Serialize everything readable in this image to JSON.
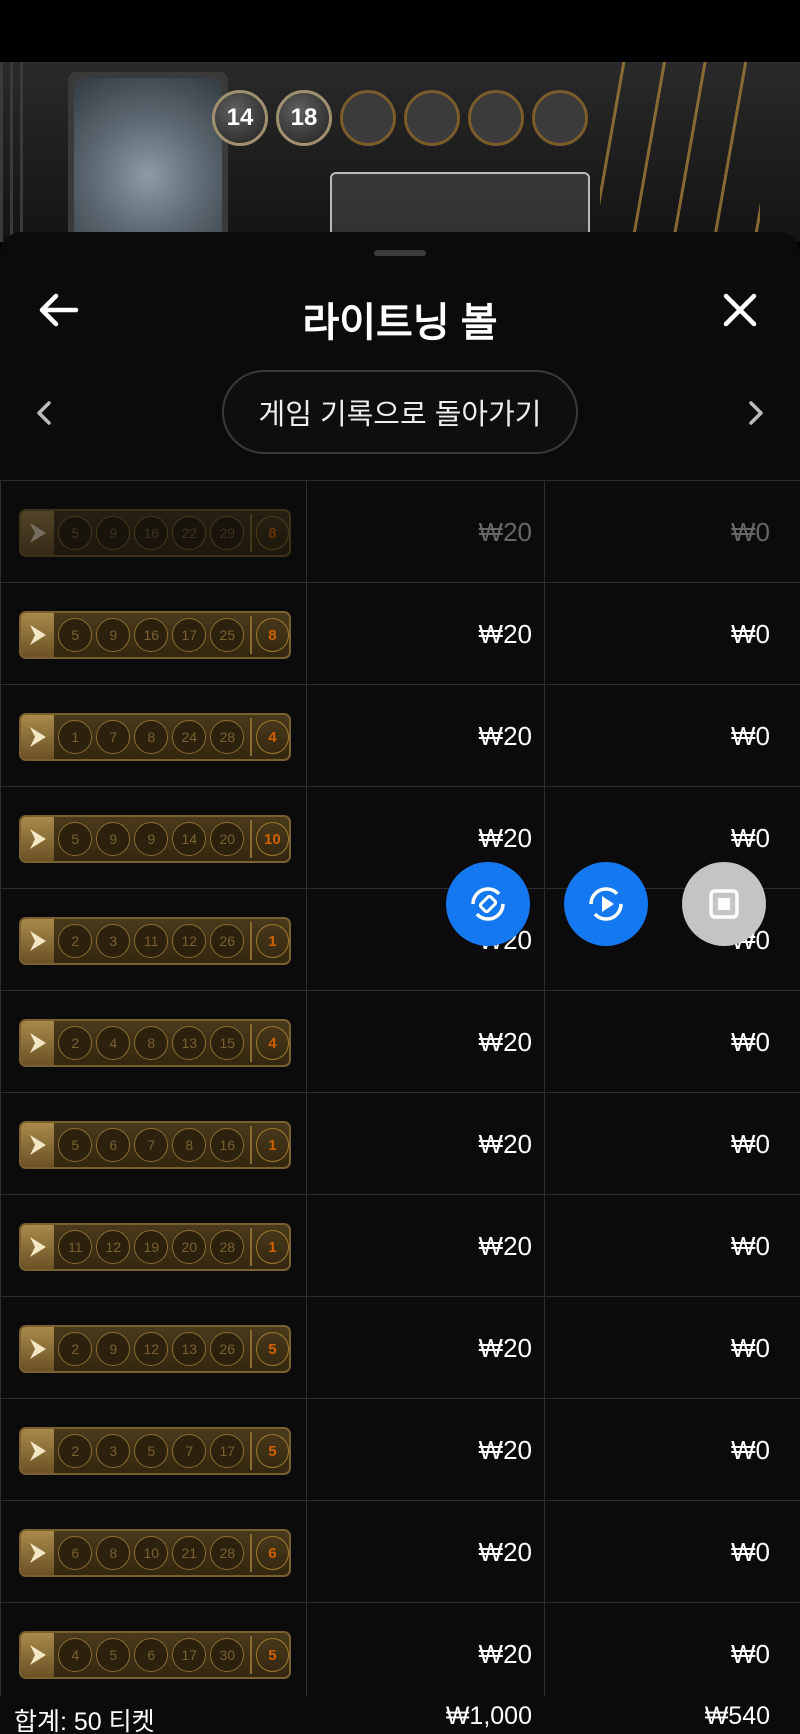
{
  "game_header": {
    "drawn_balls": [
      "14",
      "18",
      "",
      "",
      "",
      ""
    ]
  },
  "panel": {
    "title": "라이트닝 볼",
    "back_label": "게임 기록으로 돌아가기"
  },
  "tickets": [
    {
      "numbers": [
        "5",
        "9",
        "16",
        "22",
        "29"
      ],
      "multiplier": "8",
      "stake": "₩20",
      "payout": "₩0",
      "faded": true
    },
    {
      "numbers": [
        "5",
        "9",
        "16",
        "17",
        "25"
      ],
      "multiplier": "8",
      "stake": "₩20",
      "payout": "₩0"
    },
    {
      "numbers": [
        "1",
        "7",
        "8",
        "24",
        "28"
      ],
      "multiplier": "4",
      "stake": "₩20",
      "payout": "₩0"
    },
    {
      "numbers": [
        "5",
        "9",
        "9",
        "14",
        "20"
      ],
      "multiplier": "10",
      "stake": "₩20",
      "payout": "₩0"
    },
    {
      "numbers": [
        "2",
        "3",
        "11",
        "12",
        "26"
      ],
      "multiplier": "1",
      "stake": "₩20",
      "payout": "₩0"
    },
    {
      "numbers": [
        "2",
        "4",
        "8",
        "13",
        "15"
      ],
      "multiplier": "4",
      "stake": "₩20",
      "payout": "₩0"
    },
    {
      "numbers": [
        "5",
        "6",
        "7",
        "8",
        "16"
      ],
      "multiplier": "1",
      "stake": "₩20",
      "payout": "₩0"
    },
    {
      "numbers": [
        "11",
        "12",
        "19",
        "20",
        "28"
      ],
      "multiplier": "1",
      "stake": "₩20",
      "payout": "₩0"
    },
    {
      "numbers": [
        "2",
        "9",
        "12",
        "13",
        "26"
      ],
      "multiplier": "5",
      "stake": "₩20",
      "payout": "₩0"
    },
    {
      "numbers": [
        "2",
        "3",
        "5",
        "7",
        "17"
      ],
      "multiplier": "5",
      "stake": "₩20",
      "payout": "₩0"
    },
    {
      "numbers": [
        "6",
        "8",
        "10",
        "21",
        "28"
      ],
      "multiplier": "6",
      "stake": "₩20",
      "payout": "₩0"
    },
    {
      "numbers": [
        "4",
        "5",
        "6",
        "17",
        "30"
      ],
      "multiplier": "5",
      "stake": "₩20",
      "payout": "₩0"
    }
  ],
  "totals": {
    "label": "합계: 50 티켓",
    "stake": "₩1,000",
    "payout": "₩540"
  },
  "floating_controls": [
    "rotate-icon",
    "replay-icon",
    "stop-icon"
  ],
  "colors": {
    "accent_blue": "#1478f0",
    "gold": "#7a6030",
    "multiplier": "#d06000"
  }
}
